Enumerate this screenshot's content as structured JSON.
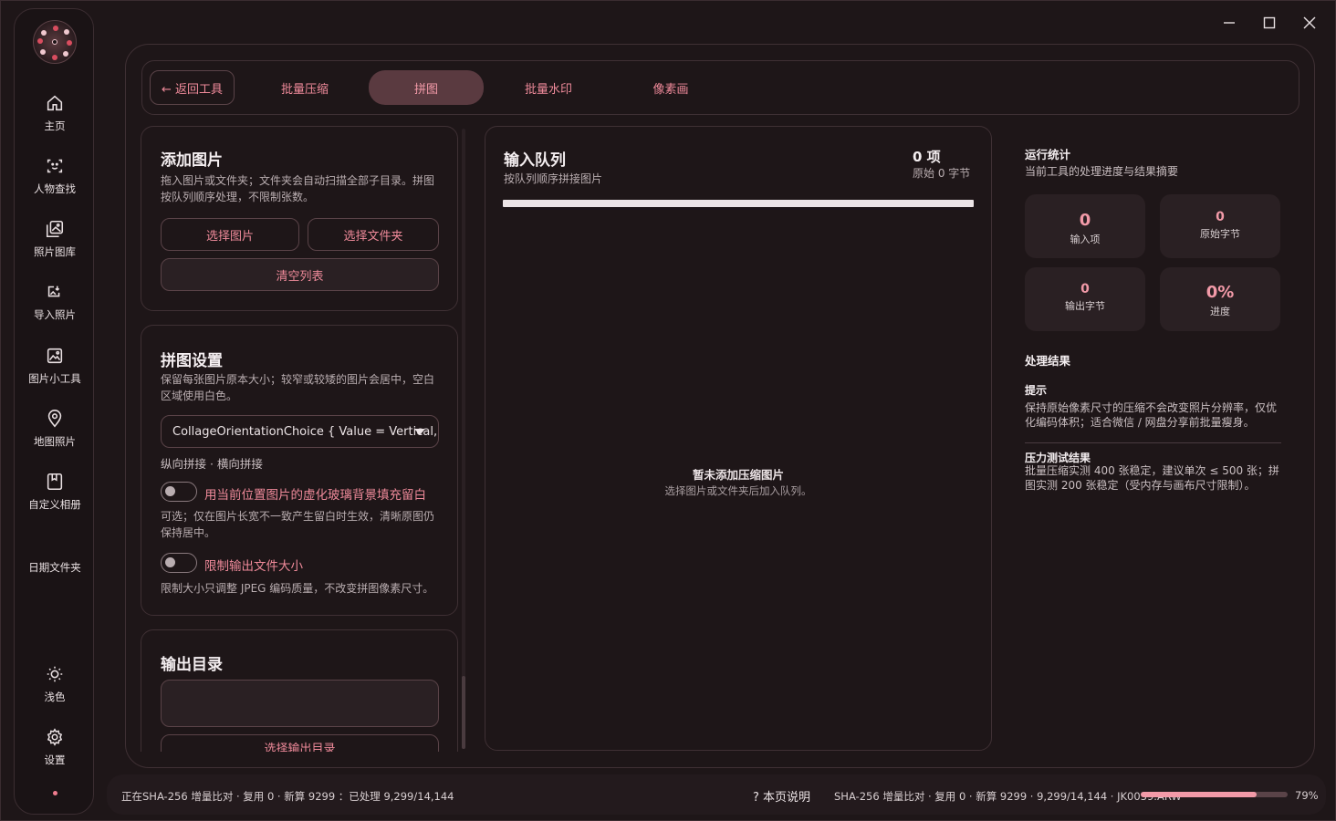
{
  "window": {
    "controls": [
      "minimize",
      "maximize",
      "close"
    ]
  },
  "sidebar": {
    "items": [
      {
        "label": "主页",
        "icon": "home-icon"
      },
      {
        "label": "人物查找",
        "icon": "face-scan-icon"
      },
      {
        "label": "照片图库",
        "icon": "photo-library-icon"
      },
      {
        "label": "导入照片",
        "icon": "import-photo-icon"
      },
      {
        "label": "图片小工具",
        "icon": "image-tools-icon"
      },
      {
        "label": "地图照片",
        "icon": "map-pin-icon"
      },
      {
        "label": "自定义相册",
        "icon": "album-icon"
      },
      {
        "label": "日期文件夹",
        "icon": ""
      }
    ],
    "bottom": [
      {
        "label": "浅色",
        "icon": "sun-icon"
      },
      {
        "label": "设置",
        "icon": "gear-icon"
      }
    ]
  },
  "tabs": {
    "back": "← 返回工具",
    "items": [
      "批量压缩",
      "拼图",
      "批量水印",
      "像素画"
    ],
    "active": "拼图"
  },
  "add_images": {
    "title": "添加图片",
    "desc": "拖入图片或文件夹；文件夹会自动扫描全部子目录。拼图按队列顺序处理，不限制张数。",
    "select_images": "选择图片",
    "select_folder": "选择文件夹",
    "clear_list": "清空列表"
  },
  "collage_settings": {
    "title": "拼图设置",
    "desc": "保留每张图片原本大小；较窄或较矮的图片会居中，空白区域使用白色。",
    "orientation_value": "CollageOrientationChoice { Value = Vertical,",
    "orientation_hint": "纵向拼接 · 横向拼接",
    "blur_fill": {
      "label": "用当前位置图片的虚化玻璃背景填充留白",
      "enabled": false
    },
    "blur_fill_desc": "可选；仅在图片长宽不一致产生留白时生效，清晰原图仍保持居中。",
    "limit_size": {
      "label": "限制输出文件大小",
      "enabled": false
    },
    "limit_size_desc": "限制大小只调整 JPEG 编码质量，不改变拼图像素尺寸。"
  },
  "output_dir": {
    "title": "输出目录",
    "path": "",
    "select_button": "选择输出目录"
  },
  "queue": {
    "title": "输入队列",
    "subtitle": "按队列顺序拼接图片",
    "count": "0 项",
    "bytes": "原始 0 字节",
    "empty_title": "暂未添加压缩图片",
    "empty_sub": "选择图片或文件夹后加入队列。"
  },
  "stats": {
    "title": "运行统计",
    "subtitle": "当前工具的处理进度与结果摘要",
    "items": [
      {
        "value": "0",
        "label": "输入项"
      },
      {
        "value": "0",
        "label": "原始字节"
      },
      {
        "value": "0",
        "label": "输出字节"
      },
      {
        "value": "0%",
        "label": "进度"
      }
    ]
  },
  "results": {
    "title": "处理结果",
    "tip_title": "提示",
    "tip_text": "保持原始像素尺寸的压缩不会改变照片分辨率，仅优化编码体积；适合微信 / 网盘分享前批量瘦身。",
    "stress_title": "压力测试结果",
    "stress_text": "批量压缩实测 400 张稳定，建议单次 ≤ 500 张；拼图实测 200 张稳定（受内存与画布尺寸限制）。"
  },
  "statusbar": {
    "left": "正在SHA-256 增量比对 · 复用 0 · 新算 9299 ：已处理 9,299/14,144",
    "help": "? 本页说明",
    "right": "SHA-256 增量比对 · 复用 0 · 新算 9299 · 9,299/14,144 · JK0039.ARW",
    "progress": 0.79,
    "progress_label": "79%"
  },
  "colors": {
    "accent": "#f29aa8",
    "accent_dim": "#ef8a9a",
    "bg": "#1e1618",
    "border": "#3f3034"
  }
}
